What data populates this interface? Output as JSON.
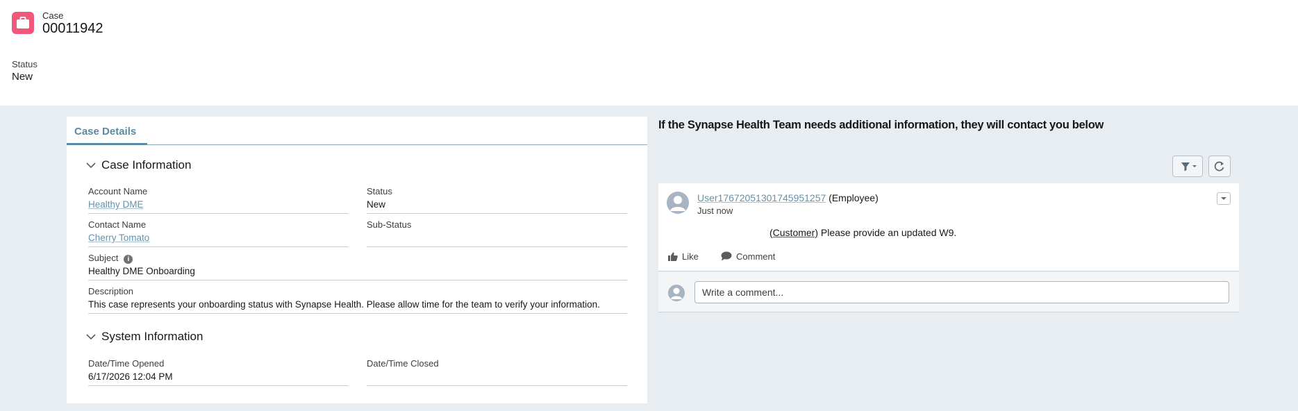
{
  "header": {
    "object_label": "Case",
    "case_number": "00011942",
    "status_label": "Status",
    "status_value": "New",
    "icon": "briefcase-icon",
    "icon_color": "#f0597c"
  },
  "details": {
    "tab_label": "Case Details",
    "case_info": {
      "heading": "Case Information",
      "account_name_label": "Account Name",
      "account_name": "Healthy DME",
      "status_label": "Status",
      "status": "New",
      "contact_name_label": "Contact Name",
      "contact_name": "Cherry Tomato",
      "sub_status_label": "Sub-Status",
      "sub_status": "",
      "subject_label": "Subject",
      "subject": "Healthy DME Onboarding",
      "description_label": "Description",
      "description": "This case represents your onboarding status with Synapse Health. Please allow time for the team to verify your information."
    },
    "system_info": {
      "heading": "System Information",
      "opened_label": "Date/Time Opened",
      "opened": "6/17/2026 12:04 PM",
      "closed_label": "Date/Time Closed",
      "closed": ""
    }
  },
  "feed": {
    "title": "If the Synapse Health Team needs additional information, they will contact you below",
    "post": {
      "author": "User1767205130174595125 7",
      "author_display": "User17672051301745951257",
      "author_role": "(Employee)",
      "time": "Just now",
      "mention": "(Customer)",
      "body": "Please provide an updated W9.",
      "like_label": "Like",
      "comment_label": "Comment"
    },
    "comment_placeholder": "Write a comment..."
  },
  "colors": {
    "link": "#6591ab",
    "tab_accent": "#5a8aa6",
    "page_background": "#e8edf2"
  }
}
